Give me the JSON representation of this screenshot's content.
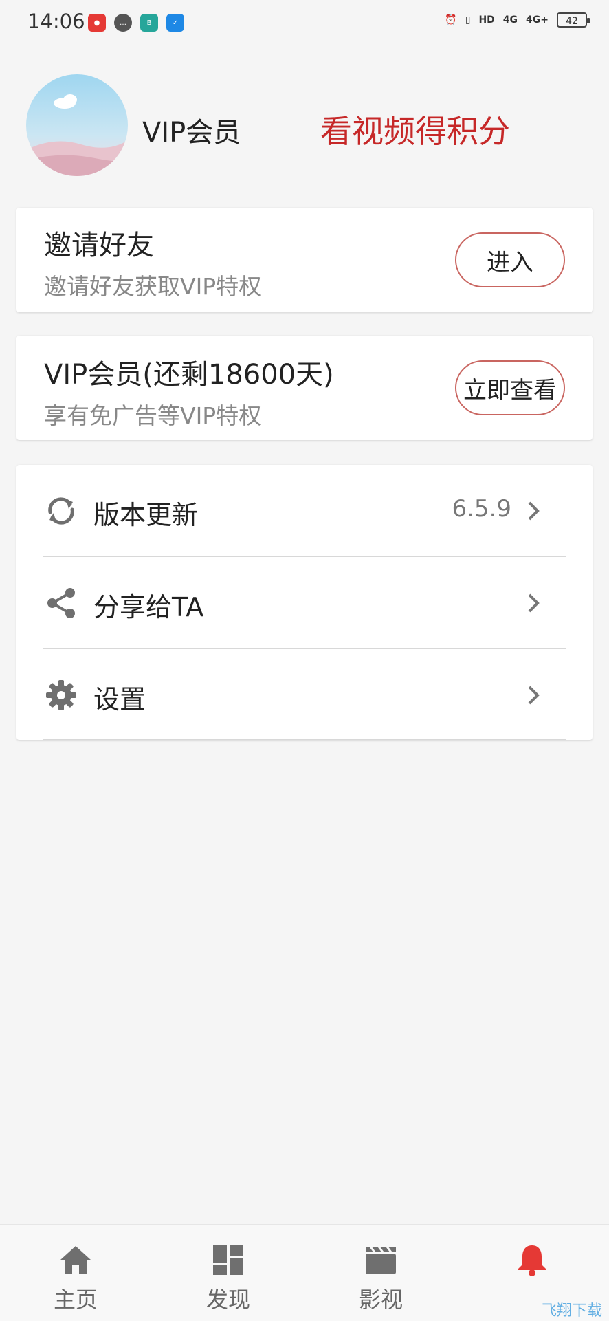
{
  "status_bar": {
    "time": "14:06",
    "apps": [
      {
        "icon": "netease-music-icon",
        "color": "#e53935"
      },
      {
        "icon": "message-bubble-icon",
        "color": "#555555"
      },
      {
        "icon": "boss-zhipin-icon",
        "color": "#26a69a"
      },
      {
        "icon": "feather-app-icon",
        "color": "#1e88e5"
      }
    ],
    "indicators": [
      "alarm-icon",
      "vibrate-icon",
      "HD",
      "4G",
      "4G+"
    ],
    "battery": "42"
  },
  "profile": {
    "name": "VIP会员",
    "earn_points_link": "看视频得积分"
  },
  "cards": {
    "invite": {
      "title": "邀请好友",
      "subtitle": "邀请好友获取VIP特权",
      "button": "进入"
    },
    "vip": {
      "title": "VIP会员(还剩18600天)",
      "subtitle": "享有免广告等VIP特权",
      "button": "立即查看"
    }
  },
  "menu": {
    "items": [
      {
        "icon": "refresh-icon",
        "label": "版本更新",
        "value": "6.5.9"
      },
      {
        "icon": "share-icon",
        "label": "分享给TA",
        "value": ""
      },
      {
        "icon": "gear-icon",
        "label": "设置",
        "value": ""
      }
    ]
  },
  "bottom_nav": {
    "items": [
      {
        "icon": "home-icon",
        "label": "主页"
      },
      {
        "icon": "dashboard-icon",
        "label": "发现"
      },
      {
        "icon": "clapperboard-icon",
        "label": "影视"
      },
      {
        "icon": "bell-icon",
        "label": ""
      }
    ]
  },
  "watermark": "飞翔下载",
  "colors": {
    "accent": "#c62828",
    "button_border": "#c96560",
    "icon_gray": "#6f6f6f",
    "bell_red": "#e53935",
    "background": "#f5f5f5"
  }
}
